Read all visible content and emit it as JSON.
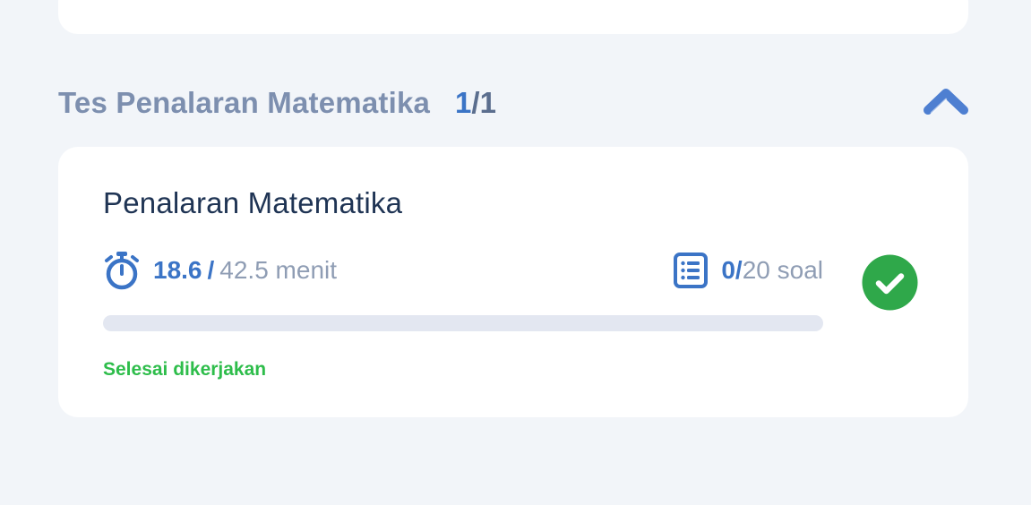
{
  "section": {
    "title": "Tes Penalaran Matematika",
    "count_current": "1",
    "count_sep_total": "/1"
  },
  "card": {
    "title": "Penalaran Matematika",
    "time_used": "18.6",
    "time_sep": "/",
    "time_total": "42.5 menit",
    "questions_done": "0",
    "questions_sep": "/",
    "questions_total": "20 soal",
    "progress_fraction": 0,
    "status": "Selesai dikerjakan"
  },
  "icons": {
    "collapse": "chevron-up-icon",
    "timer": "stopwatch-icon",
    "questions": "list-document-icon",
    "status": "check-circle-icon"
  },
  "colors": {
    "accent": "#3b74c6",
    "success": "#2ebd4b",
    "muted_text": "#8f9db4",
    "progress_track": "#e3e7f1",
    "background": "#f2f5f9"
  }
}
